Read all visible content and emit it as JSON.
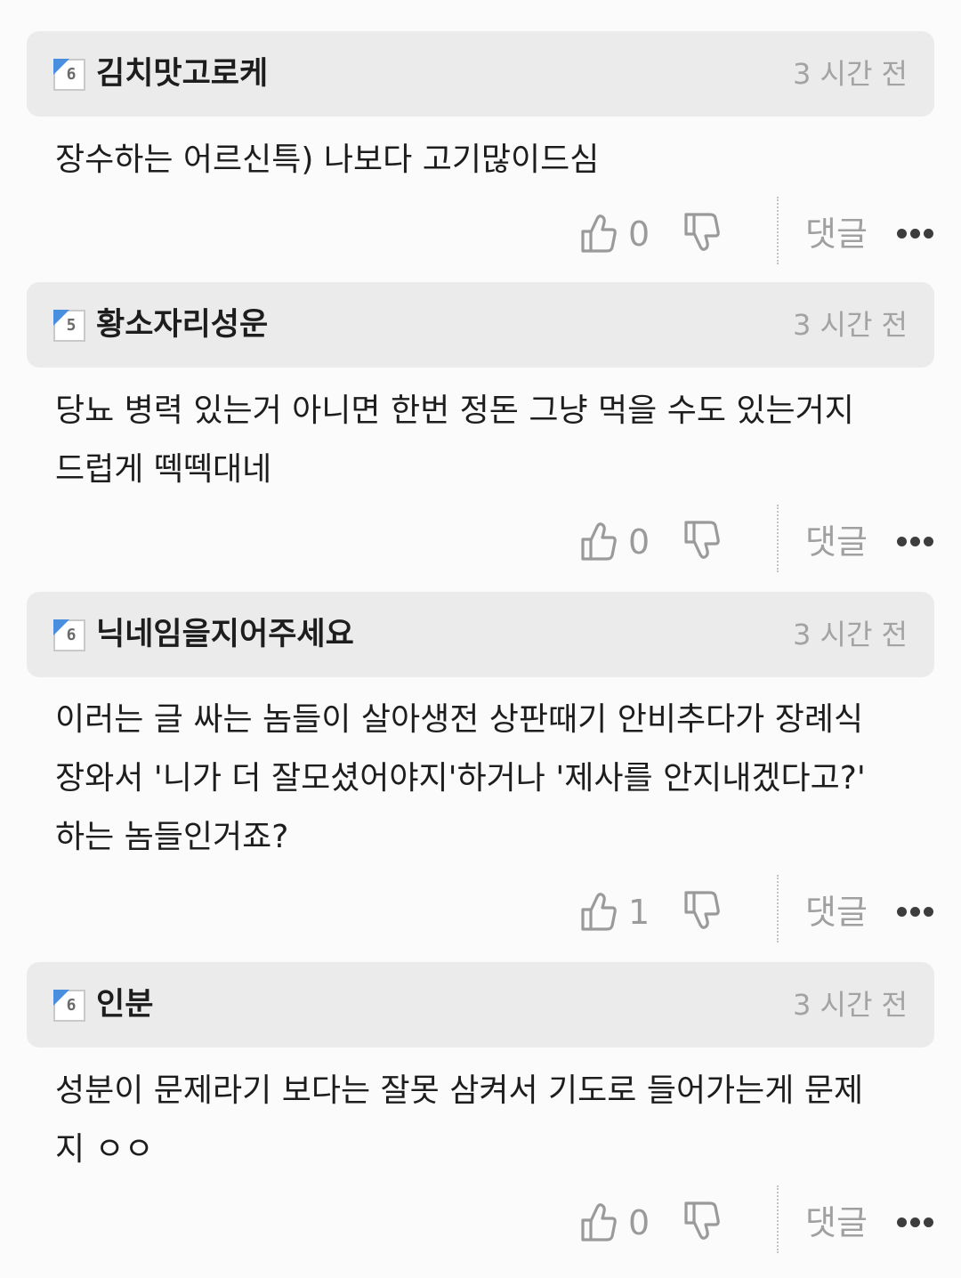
{
  "comments": [
    {
      "level": "6",
      "nickname": "김치맛고로케",
      "time": "3 시간 전",
      "body": "장수하는 어르신특) 나보다 고기많이드심",
      "likes": "0",
      "reply_label": "댓글"
    },
    {
      "level": "5",
      "nickname": "황소자리성운",
      "time": "3 시간 전",
      "body": "당뇨 병력 있는거 아니면 한번 정돈 그냥 먹을 수도 있는거지\n드럽게 떽떽대네",
      "likes": "0",
      "reply_label": "댓글"
    },
    {
      "level": "6",
      "nickname": "닉네임을지어주세요",
      "time": "3 시간 전",
      "body": "이러는 글 싸는 놈들이 살아생전 상판때기 안비추다가 장례식\n장와서 '니가 더 잘모셨어야지'하거나 '제사를 안지내겠다고?'\n하는 놈들인거죠?",
      "likes": "1",
      "reply_label": "댓글"
    },
    {
      "level": "6",
      "nickname": "인분",
      "time": "3 시간 전",
      "body": "성분이 문제라기 보다는 잘못 삼켜서 기도로 들어가는게 문제\n지 ㅇㅇ",
      "likes": "0",
      "reply_label": "댓글"
    }
  ],
  "icons": {
    "like": "thumbs-up-outline",
    "dislike": "thumbs-down-outline",
    "more": "three-dots-horizontal"
  },
  "colors": {
    "header_bg": "#ebebeb",
    "badge_flag": "#4a8ee0",
    "muted_text": "#a3a3a3",
    "body_text": "#1d1d1d"
  }
}
